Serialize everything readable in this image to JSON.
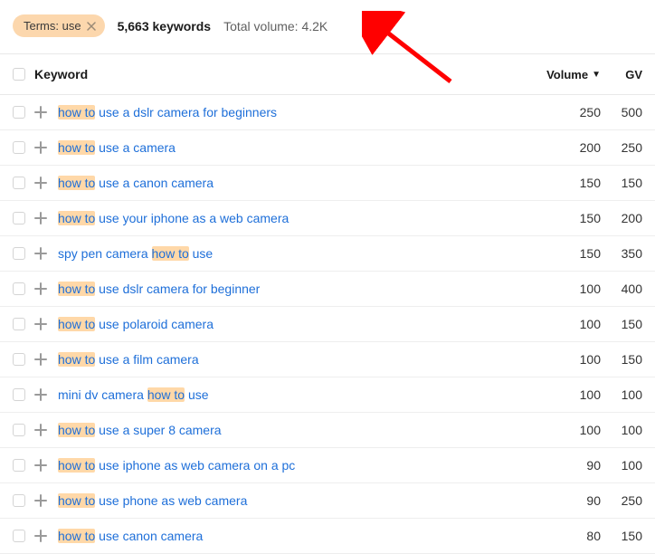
{
  "filter": {
    "label": "Terms: use"
  },
  "summary": {
    "keyword_count": "5,663 keywords",
    "total_volume_label": "Total volume: 4.2K"
  },
  "columns": {
    "keyword": "Keyword",
    "volume": "Volume",
    "gv": "GV"
  },
  "highlight_phrase": "how to",
  "rows": [
    {
      "keyword": "how to use a dslr camera for beginners",
      "volume": "250",
      "gv": "500"
    },
    {
      "keyword": "how to use a camera",
      "volume": "200",
      "gv": "250"
    },
    {
      "keyword": "how to use a canon camera",
      "volume": "150",
      "gv": "150"
    },
    {
      "keyword": "how to use your iphone as a web camera",
      "volume": "150",
      "gv": "200"
    },
    {
      "keyword": "spy pen camera how to use",
      "volume": "150",
      "gv": "350"
    },
    {
      "keyword": "how to use dslr camera for beginner",
      "volume": "100",
      "gv": "400"
    },
    {
      "keyword": "how to use polaroid camera",
      "volume": "100",
      "gv": "150"
    },
    {
      "keyword": "how to use a film camera",
      "volume": "100",
      "gv": "150"
    },
    {
      "keyword": "mini dv camera how to use",
      "volume": "100",
      "gv": "100"
    },
    {
      "keyword": "how to use a super 8 camera",
      "volume": "100",
      "gv": "100"
    },
    {
      "keyword": "how to use iphone as web camera on a pc",
      "volume": "90",
      "gv": "100"
    },
    {
      "keyword": "how to use phone as web camera",
      "volume": "90",
      "gv": "250"
    },
    {
      "keyword": "how to use canon camera",
      "volume": "80",
      "gv": "150"
    }
  ]
}
